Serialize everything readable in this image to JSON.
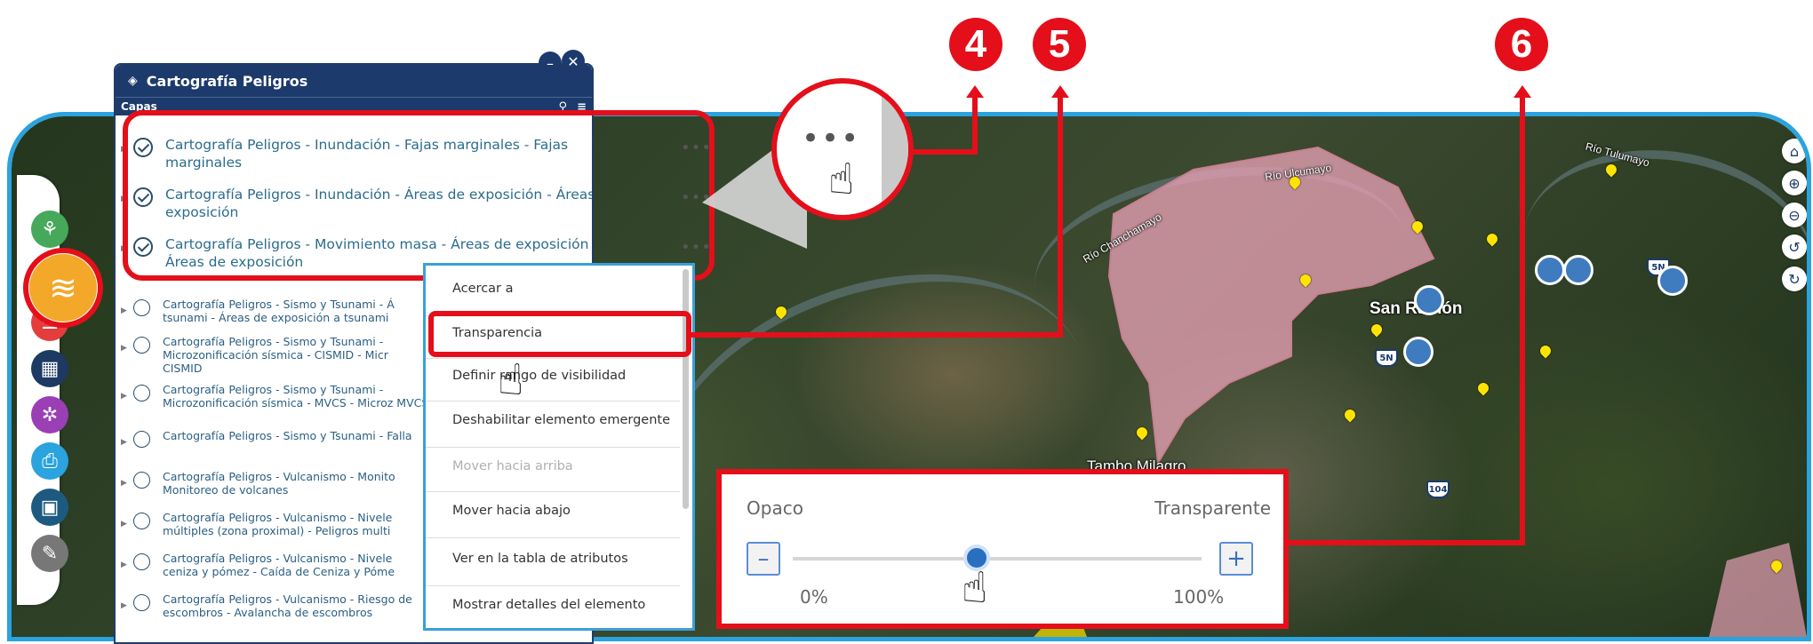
{
  "panel": {
    "title": "Cartografía Peligros",
    "subheader": "Capas",
    "highlighted_layers": [
      {
        "label": "Cartografía Peligros - Inundación - Fajas marginales - Fajas marginales"
      },
      {
        "label": "Cartografía Peligros - Inundación - Áreas de exposición - Áreas de exposición"
      },
      {
        "label": "Cartografía Peligros - Movimiento masa - Áreas de exposición - Áreas de exposición"
      }
    ],
    "other_layers": [
      {
        "label": "Cartografía Peligros - Sismo y Tsunami - Á tsunami - Áreas de exposición a tsunami"
      },
      {
        "label": "Cartografía Peligros - Sismo y Tsunami - Microzonificación sísmica - CISMID - Micr CISMID"
      },
      {
        "label": "Cartografía Peligros - Sismo y Tsunami - Microzonificación sísmica - MVCS - Microz MVCS"
      },
      {
        "label": "Cartografía Peligros - Sismo y Tsunami - Falla"
      },
      {
        "label": "Cartografía Peligros - Vulcanismo - Monito Monitoreo de volcanes"
      },
      {
        "label": "Cartografía Peligros - Vulcanismo - Nivele múltiples (zona proximal) - Peligros multi"
      },
      {
        "label": "Cartografía Peligros - Vulcanismo - Nivele ceniza y pómez - Caída de Ceniza y Póme"
      },
      {
        "label": "Cartografía Peligros - Vulcanismo - Riesgo de escombros - Avalancha de escombros"
      }
    ]
  },
  "context_menu": {
    "items": [
      {
        "label": "Acercar a"
      },
      {
        "label": "Transparencia"
      },
      {
        "label": "Definir rango de visibilidad"
      },
      {
        "label": "Deshabilitar elemento emergente"
      },
      {
        "label": "Mover hacia arriba"
      },
      {
        "label": "Mover hacia abajo"
      },
      {
        "label": "Ver en la tabla de atributos"
      },
      {
        "label": "Mostrar detalles del elemento"
      }
    ]
  },
  "transparency": {
    "left_label": "Opaco",
    "right_label": "Transparente",
    "min_label": "0%",
    "max_label": "100%",
    "minus": "–",
    "plus": "+",
    "value_percent": 45
  },
  "callouts": [
    "4",
    "5",
    "6"
  ],
  "map_labels": {
    "town": "San Ramón",
    "place": "Tambo Milagro",
    "river1": "Río Ulcumayo",
    "river2": "Río Chanchamayo",
    "river3": "Río Tulumayo",
    "road1": "104",
    "road2": "5N",
    "road3": "5N"
  },
  "colors": {
    "accent_red": "#e40f1a",
    "panel_blue": "#1c3a6b",
    "frame_blue": "#2aa3de",
    "hazard_pink": "#e6a0b4"
  },
  "icons": {
    "ellipsis": "•••"
  }
}
